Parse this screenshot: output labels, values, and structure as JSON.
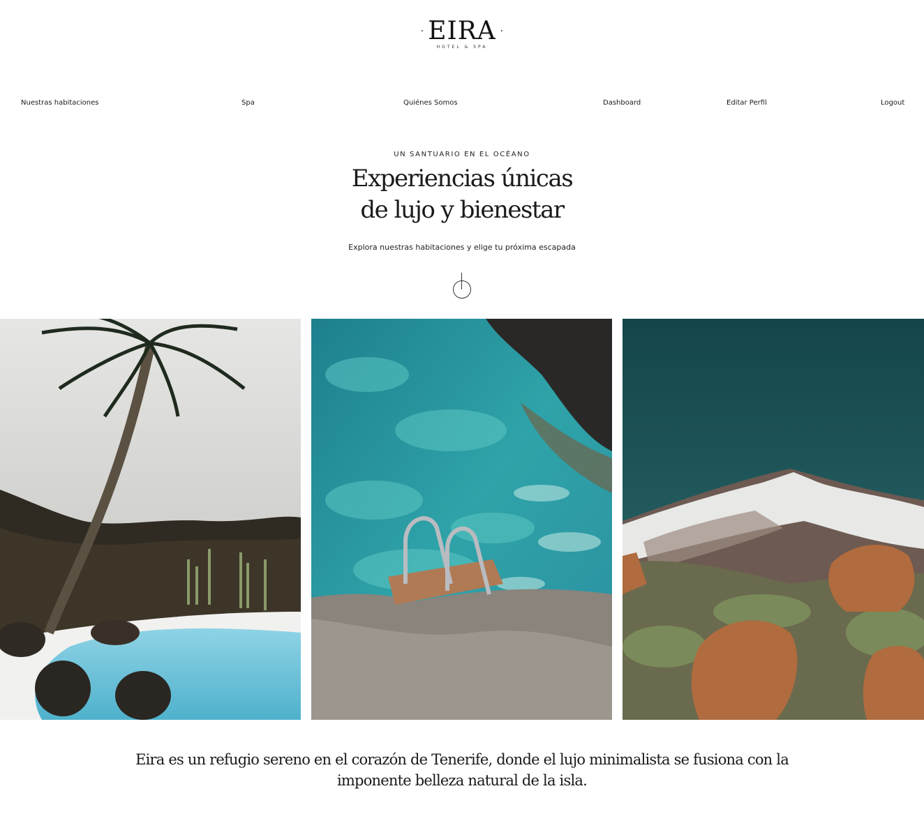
{
  "brand": {
    "name": "EIRA",
    "tagline": "HOTEL & SPA",
    "ornament": "·"
  },
  "nav": {
    "items": [
      {
        "label": "Nuestras habitaciones"
      },
      {
        "label": "Spa"
      },
      {
        "label": "Quiénes Somos"
      },
      {
        "label": "Dashboard"
      },
      {
        "label": "Editar Perfil"
      },
      {
        "label": "Logout"
      }
    ]
  },
  "hero": {
    "eyebrow": "UN SANTUARIO EN EL OCÉANO",
    "headline_line1": "Experiencias únicas",
    "headline_line2": "de lujo y bienestar",
    "subtext": "Explora nuestras habitaciones y elige tu próxima escapada",
    "scroll_icon": "scroll-down-icon"
  },
  "gallery": {
    "images": [
      {
        "subject": "palm-pool-lagoon"
      },
      {
        "subject": "ocean-pool-ladder"
      },
      {
        "subject": "snowy-volcano-teide"
      }
    ]
  },
  "statement": {
    "line1": "Eira es un refugio sereno en el corazón de Tenerife, donde el lujo minimalista se fusiona con la",
    "line2": "imponente belleza natural de la isla."
  },
  "colors": {
    "background": "#ffffff",
    "text": "#1a1a1a"
  }
}
